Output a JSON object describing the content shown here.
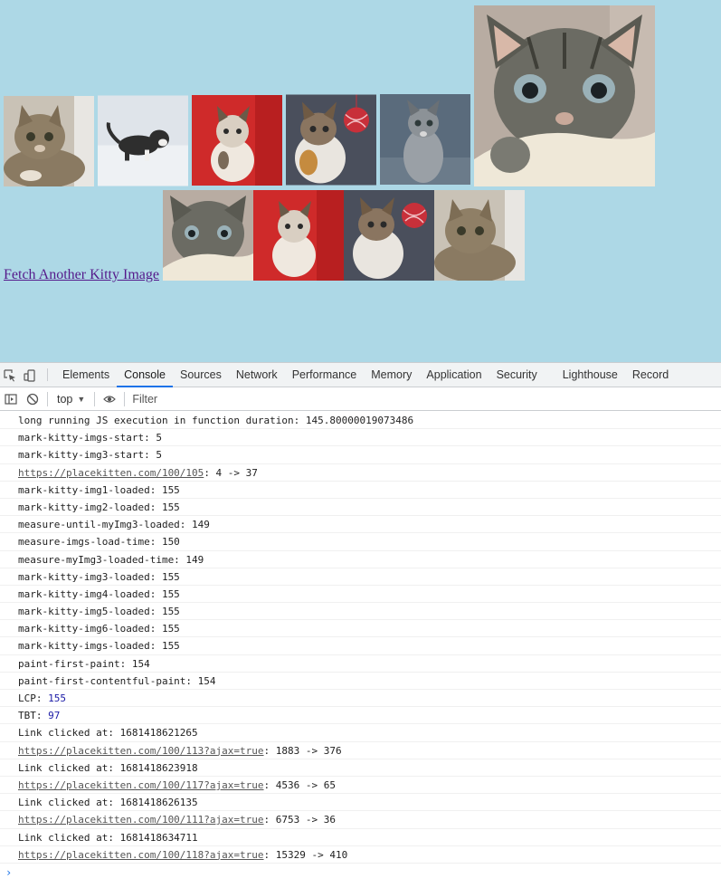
{
  "page": {
    "background": "#add8e6",
    "link_text": "Fetch Another Kitty Image",
    "kitten_images": [
      {
        "name": "kitten-tabby-lying"
      },
      {
        "name": "kitten-in-snow"
      },
      {
        "name": "kitten-red-background"
      },
      {
        "name": "kitten-with-yarn-ball"
      },
      {
        "name": "kitten-gray-standing"
      },
      {
        "name": "kitten-large-closeup"
      },
      {
        "name": "kitten-closeup-small"
      },
      {
        "name": "kitten-red-background-2"
      },
      {
        "name": "kitten-with-yarn-ball-2"
      },
      {
        "name": "kitten-tabby-lying-2"
      }
    ]
  },
  "devtools": {
    "tabs": [
      "Elements",
      "Console",
      "Sources",
      "Network",
      "Performance",
      "Memory",
      "Application",
      "Security",
      "Lighthouse",
      "Record"
    ],
    "active_tab": "Console",
    "toolbar": {
      "context": "top",
      "filter_placeholder": "Filter"
    },
    "console": [
      {
        "text": "long running JS execution in function duration: 145.80000019073486"
      },
      {
        "text": "mark-kitty-imgs-start: 5"
      },
      {
        "text": "mark-kitty-img3-start: 5"
      },
      {
        "url": "https://placekitten.com/100/105",
        "text": ": 4 -> 37"
      },
      {
        "text": "mark-kitty-img1-loaded: 155"
      },
      {
        "text": "mark-kitty-img2-loaded: 155"
      },
      {
        "text": "measure-until-myImg3-loaded: 149"
      },
      {
        "text": "measure-imgs-load-time: 150"
      },
      {
        "text": "measure-myImg3-loaded-time: 149"
      },
      {
        "text": "mark-kitty-img3-loaded: 155"
      },
      {
        "text": "mark-kitty-img4-loaded: 155"
      },
      {
        "text": "mark-kitty-img5-loaded: 155"
      },
      {
        "text": "mark-kitty-img6-loaded: 155"
      },
      {
        "text": "mark-kitty-imgs-loaded: 155"
      },
      {
        "text": "paint-first-paint: 154"
      },
      {
        "text": "paint-first-contentful-paint: 154"
      },
      {
        "label": "LCP: ",
        "value": "155"
      },
      {
        "label": "TBT: ",
        "value": "97"
      },
      {
        "text": "Link clicked at: 1681418621265"
      },
      {
        "url": "https://placekitten.com/100/113?ajax=true",
        "text": ": 1883 -> 376"
      },
      {
        "text": "Link clicked at: 1681418623918"
      },
      {
        "url": "https://placekitten.com/100/117?ajax=true",
        "text": ": 4536 -> 65"
      },
      {
        "text": "Link clicked at: 1681418626135"
      },
      {
        "url": "https://placekitten.com/100/111?ajax=true",
        "text": ": 6753 -> 36"
      },
      {
        "text": "Link clicked at: 1681418634711"
      },
      {
        "url": "https://placekitten.com/100/118?ajax=true",
        "text": ": 15329 -> 410"
      }
    ],
    "prompt_symbol": "›"
  }
}
